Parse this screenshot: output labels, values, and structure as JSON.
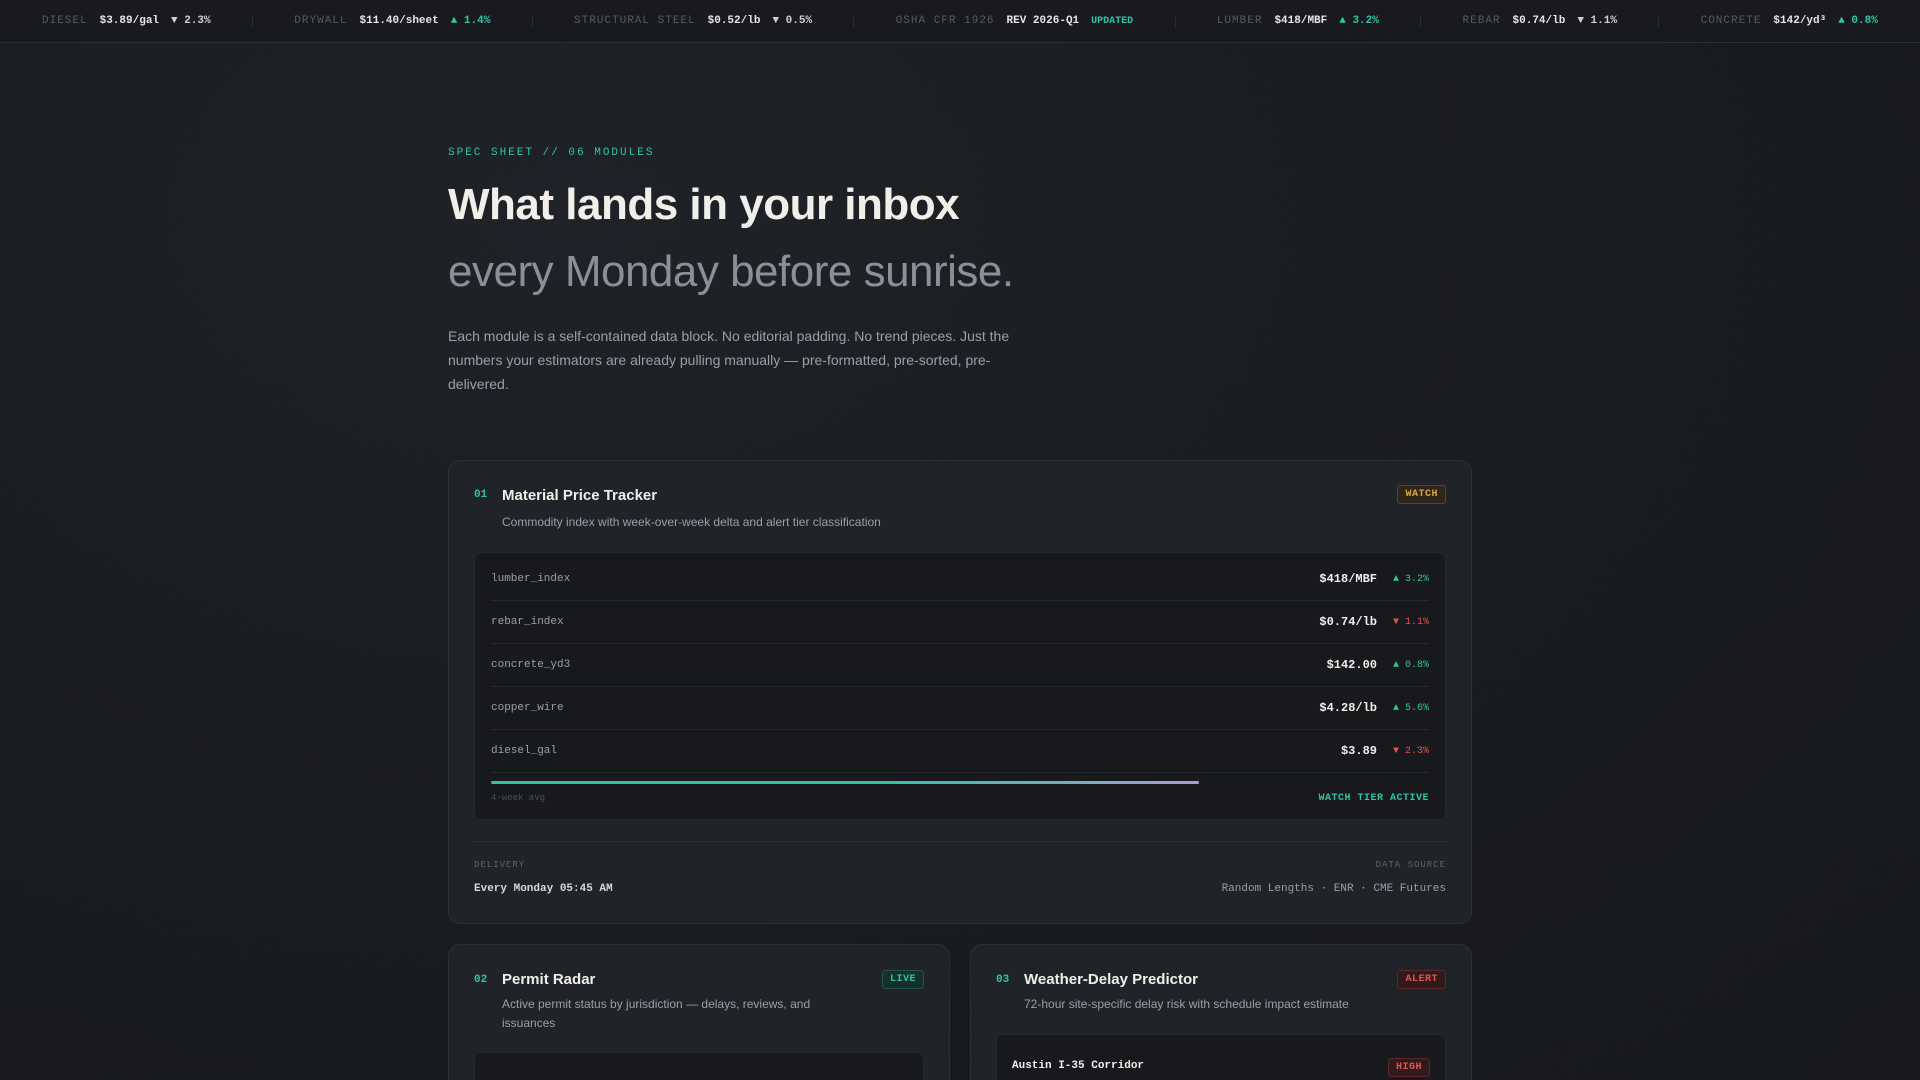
{
  "ticker": [
    {
      "label": "DIESEL",
      "value": "$3.89/gal",
      "delta": "▼ 2.3%",
      "dir": "down"
    },
    {
      "label": "DRYWALL",
      "value": "$11.40/sheet",
      "delta": "▲ 1.4%",
      "dir": "up"
    },
    {
      "label": "STRUCTURAL STEEL",
      "value": "$0.52/lb",
      "delta": "▼ 0.5%",
      "dir": "down"
    },
    {
      "label": "OSHA CFR 1926",
      "value": "REV 2026-Q1",
      "delta": "UPDATED",
      "dir": "updated"
    },
    {
      "label": "LUMBER",
      "value": "$418/MBF",
      "delta": "▲ 3.2%",
      "dir": "up"
    },
    {
      "label": "REBAR",
      "value": "$0.74/lb",
      "delta": "▼ 1.1%",
      "dir": "down"
    },
    {
      "label": "CONCRETE",
      "value": "$142/yd³",
      "delta": "▲ 0.8%",
      "dir": "up"
    }
  ],
  "hero": {
    "eyebrow": "SPEC SHEET // 06 MODULES",
    "title": "What lands in your inbox",
    "subtitle": "every Monday before sunrise.",
    "lede": "Each module is a self-contained data block. No editorial padding. No trend pieces. Just the numbers your estimators are already pulling manually — pre-formatted, pre-sorted, pre-delivered."
  },
  "modules": {
    "tracker": {
      "num": "01",
      "title": "Material Price Tracker",
      "desc": "Commodity index with week-over-week delta and alert tier classification",
      "badge": "WATCH",
      "rows": [
        {
          "key": "lumber_index",
          "value": "$418/MBF",
          "delta": "▲ 3.2%",
          "dir": "up"
        },
        {
          "key": "rebar_index",
          "value": "$0.74/lb",
          "delta": "▼ 1.1%",
          "dir": "down"
        },
        {
          "key": "concrete_yd3",
          "value": "$142.00",
          "delta": "▲ 0.8%",
          "dir": "up"
        },
        {
          "key": "copper_wire",
          "value": "$4.28/lb",
          "delta": "▲ 5.6%",
          "dir": "up"
        },
        {
          "key": "diesel_gal",
          "value": "$3.89",
          "delta": "▼ 2.3%",
          "dir": "down"
        }
      ],
      "progress_fraction": 0.755,
      "bar_label": "4-week avg",
      "bar_status": "WATCH TIER ACTIVE",
      "delivery_label": "DELIVERY",
      "delivery_value": "Every Monday 05:45 AM",
      "source_label": "DATA SOURCE",
      "source_value": "Random Lengths · ENR · CME Futures"
    },
    "permit": {
      "num": "02",
      "title": "Permit Radar",
      "desc": "Active permit status by jurisdiction — delays, reviews, and issuances",
      "badge": "LIVE"
    },
    "weather": {
      "num": "03",
      "title": "Weather-Delay Predictor",
      "desc": "72-hour site-specific delay risk with schedule impact estimate",
      "badge": "ALERT",
      "site": "Austin I-35 Corridor",
      "risk": "HIGH"
    }
  },
  "colors": {
    "accent": "#2ec4a5",
    "warn": "#e0a53a",
    "alert": "#e25454"
  }
}
